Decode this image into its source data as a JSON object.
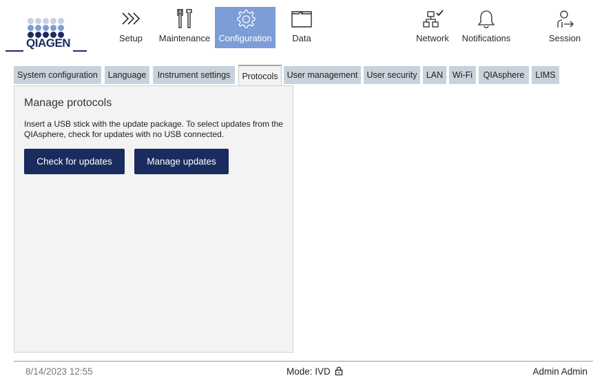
{
  "app": {
    "logo_text": "QIAGEN",
    "accent_color": "#7c9dd6",
    "brand_color": "#1a2b5e"
  },
  "nav": {
    "setup": {
      "label": "Setup",
      "icon": "chevrons-right-icon"
    },
    "maintenance": {
      "label": "Maintenance",
      "icon": "tools-icon"
    },
    "configuration": {
      "label": "Configuration",
      "icon": "gear-icon",
      "active": true
    },
    "data": {
      "label": "Data",
      "icon": "folder-icon"
    },
    "network": {
      "label": "Network",
      "icon": "network-connected-icon"
    },
    "notifications": {
      "label": "Notifications",
      "icon": "bell-icon"
    },
    "session": {
      "label": "Session",
      "icon": "user-logout-icon"
    }
  },
  "tabs": [
    {
      "label": "System configuration"
    },
    {
      "label": "Language"
    },
    {
      "label": "Instrument settings"
    },
    {
      "label": "Protocols",
      "active": true
    },
    {
      "label": "User management"
    },
    {
      "label": "User security"
    },
    {
      "label": "LAN"
    },
    {
      "label": "Wi-Fi"
    },
    {
      "label": "QIAsphere"
    },
    {
      "label": "LIMS"
    }
  ],
  "panel": {
    "title": "Manage protocols",
    "description": "Insert a USB stick with the update package. To select updates from the QIAsphere, check for updates with no USB connected.",
    "check_button": "Check for updates",
    "manage_button": "Manage updates"
  },
  "footer": {
    "datetime": "8/14/2023 12:55",
    "mode": "Mode: IVD",
    "mode_icon": "lock-icon",
    "user": "Admin Admin"
  }
}
